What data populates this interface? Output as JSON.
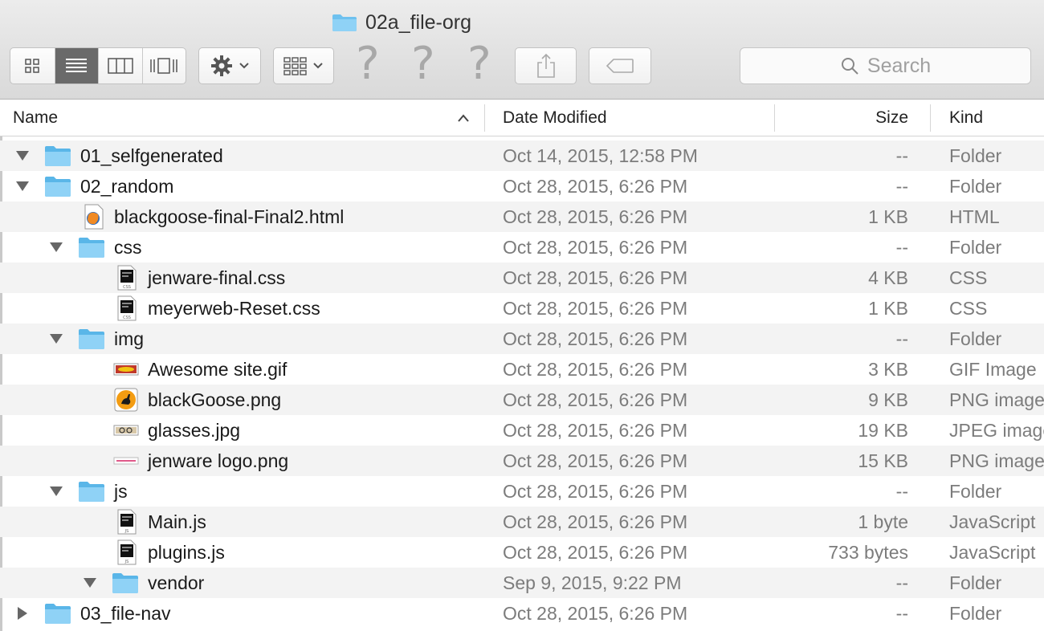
{
  "window": {
    "title": "02a_file-org"
  },
  "toolbar": {
    "view_modes": [
      "icon-view",
      "list-view",
      "column-view",
      "coverflow-view"
    ],
    "active_view": "list-view",
    "search_placeholder": "Search",
    "unknown_items": [
      "?",
      "?",
      "?"
    ]
  },
  "columns": {
    "name": "Name",
    "date": "Date Modified",
    "size": "Size",
    "kind": "Kind",
    "sort_indicator": "^"
  },
  "colors": {
    "folder": "#7ccbf4",
    "folder_dark": "#5ab6e8",
    "muted_text": "#7c7c7c",
    "alt_row": "#f3f3f3"
  },
  "rows": [
    {
      "name": "01_selfgenerated",
      "date": "Oct 14, 2015, 12:58 PM",
      "size": "--",
      "kind": "Folder",
      "icon": "folder-icon",
      "disclosure": "expanded"
    },
    {
      "name": "02_random",
      "date": "Oct 28, 2015, 6:26 PM",
      "size": "--",
      "kind": "Folder",
      "icon": "folder-icon",
      "disclosure": "expanded"
    },
    {
      "name": "blackgoose-final-Final2.html",
      "date": "Oct 28, 2015, 6:26 PM",
      "size": "1 KB",
      "kind": "HTML",
      "icon": "firefox-html-icon",
      "disclosure": "none"
    },
    {
      "name": "css",
      "date": "Oct 28, 2015, 6:26 PM",
      "size": "--",
      "kind": "Folder",
      "icon": "folder-icon",
      "disclosure": "expanded"
    },
    {
      "name": "jenware-final.css",
      "date": "Oct 28, 2015, 6:26 PM",
      "size": "4 KB",
      "kind": "CSS",
      "icon": "css-file-icon",
      "disclosure": "none"
    },
    {
      "name": "meyerweb-Reset.css",
      "date": "Oct 28, 2015, 6:26 PM",
      "size": "1 KB",
      "kind": "CSS",
      "icon": "css-file-icon",
      "disclosure": "none"
    },
    {
      "name": "img",
      "date": "Oct 28, 2015, 6:26 PM",
      "size": "--",
      "kind": "Folder",
      "icon": "folder-icon",
      "disclosure": "expanded"
    },
    {
      "name": "Awesome site.gif",
      "date": "Oct 28, 2015, 6:26 PM",
      "size": "3 KB",
      "kind": "GIF Image",
      "icon": "gif-thumbnail-icon",
      "disclosure": "none"
    },
    {
      "name": "blackGoose.png",
      "date": "Oct 28, 2015, 6:26 PM",
      "size": "9 KB",
      "kind": "PNG image",
      "icon": "goose-thumbnail-icon",
      "disclosure": "none"
    },
    {
      "name": "glasses.jpg",
      "date": "Oct 28, 2015, 6:26 PM",
      "size": "19 KB",
      "kind": "JPEG image",
      "icon": "jpg-thumbnail-icon",
      "disclosure": "none"
    },
    {
      "name": "jenware logo.png",
      "date": "Oct 28, 2015, 6:26 PM",
      "size": "15 KB",
      "kind": "PNG image",
      "icon": "logo-thumbnail-icon",
      "disclosure": "none"
    },
    {
      "name": "js",
      "date": "Oct 28, 2015, 6:26 PM",
      "size": "--",
      "kind": "Folder",
      "icon": "folder-icon",
      "disclosure": "expanded"
    },
    {
      "name": "Main.js",
      "date": "Oct 28, 2015, 6:26 PM",
      "size": "1 byte",
      "kind": "JavaScript",
      "icon": "js-file-icon",
      "disclosure": "none"
    },
    {
      "name": "plugins.js",
      "date": "Oct 28, 2015, 6:26 PM",
      "size": "733 bytes",
      "kind": "JavaScript",
      "icon": "js-file-icon",
      "disclosure": "none"
    },
    {
      "name": "vendor",
      "date": "Sep 9, 2015, 9:22 PM",
      "size": "--",
      "kind": "Folder",
      "icon": "folder-icon",
      "disclosure": "expanded"
    },
    {
      "name": "03_file-nav",
      "date": "Oct 28, 2015, 6:26 PM",
      "size": "--",
      "kind": "Folder",
      "icon": "folder-icon",
      "disclosure": "collapsed"
    }
  ]
}
